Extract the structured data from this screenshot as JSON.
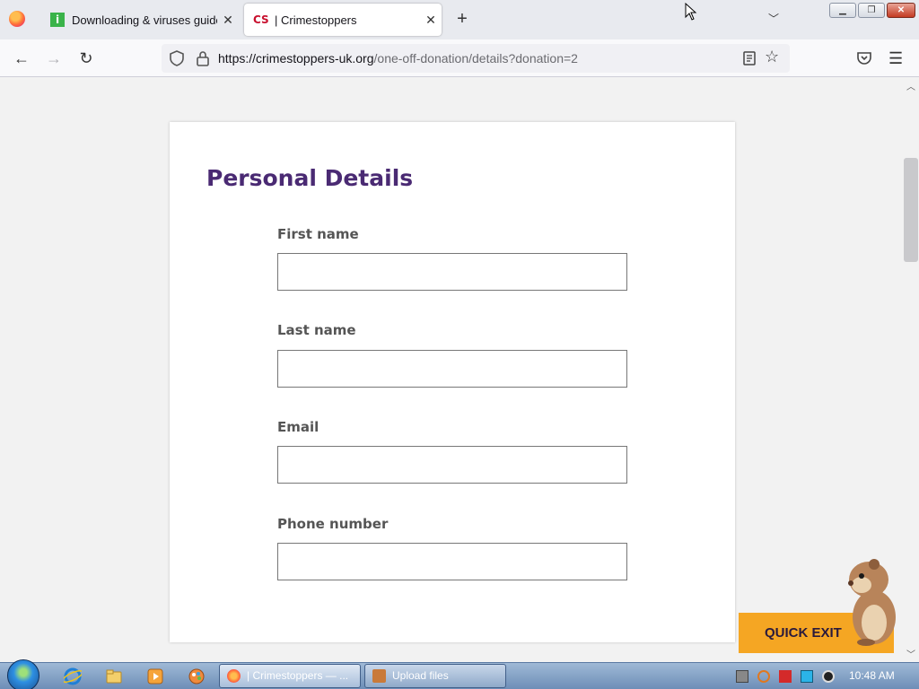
{
  "browser": {
    "tabs": [
      {
        "title": "Downloading & viruses guide -",
        "favicon": "info-favicon",
        "active": false
      },
      {
        "title": "| Crimestoppers",
        "favicon": "CS",
        "active": true
      }
    ],
    "url_host": "https://crimestoppers-uk.org",
    "url_path": "/one-off-donation/details?donation=2"
  },
  "form": {
    "heading": "Personal Details",
    "fields": [
      {
        "label": "First name",
        "value": ""
      },
      {
        "label": "Last name",
        "value": ""
      },
      {
        "label": "Email",
        "value": ""
      },
      {
        "label": "Phone number",
        "value": ""
      }
    ]
  },
  "quick_exit": {
    "label": "QUICK EXIT"
  },
  "taskbar": {
    "tasks": [
      {
        "label": "| Crimestoppers — ..."
      },
      {
        "label": "Upload files"
      }
    ],
    "clock": "10:48 AM"
  },
  "colors": {
    "heading": "#4a2a73",
    "quick_exit_bg": "#f5a623",
    "accent_red": "#c8102e"
  }
}
